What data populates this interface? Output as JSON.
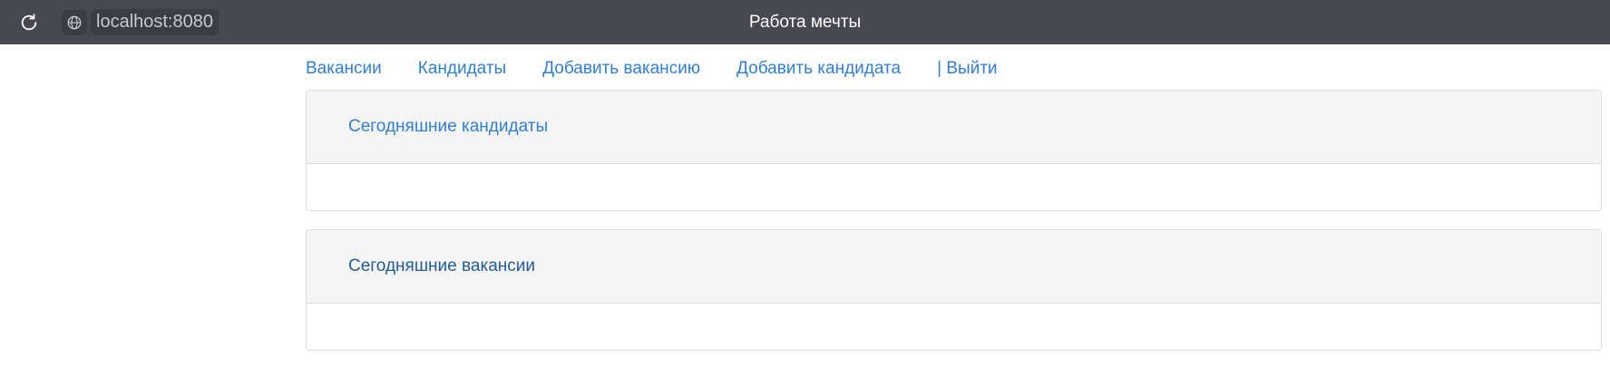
{
  "browser": {
    "url": "localhost:8080",
    "page_title": "Работа мечты"
  },
  "nav": {
    "items": [
      "Вакансии",
      "Кандидаты",
      "Добавить вакансию",
      "Добавить кандидата",
      "| Выйти"
    ]
  },
  "panels": [
    {
      "title": "Сегодняшние кандидаты"
    },
    {
      "title": "Сегодняшние вакансии"
    }
  ],
  "colors": {
    "topbar": "#474851",
    "link": "#2f7fd6",
    "panel_header": "#f5f5f5",
    "border": "#dddddd"
  }
}
